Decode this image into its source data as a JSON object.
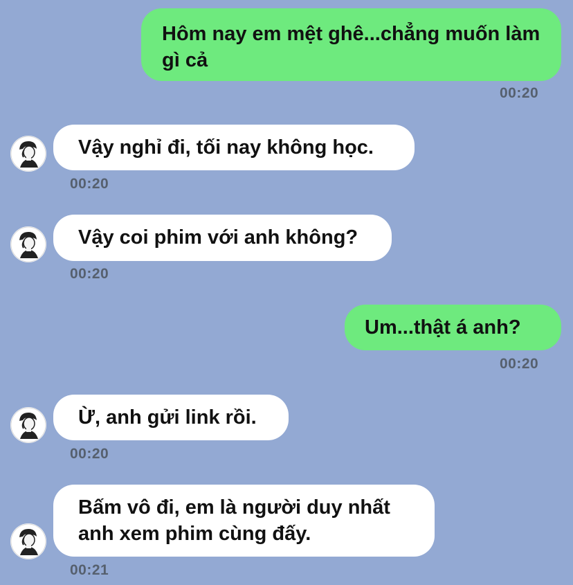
{
  "messages": [
    {
      "side": "out",
      "text": "Hôm nay em mệt ghê...chẳng muốn làm gì cả",
      "time": "00:20"
    },
    {
      "side": "in",
      "text": "Vậy nghỉ đi, tối nay không học.",
      "time": "00:20",
      "avatar": "profile-avatar"
    },
    {
      "side": "in",
      "text": "Vậy coi phim với anh không?",
      "time": "00:20",
      "avatar": "profile-avatar"
    },
    {
      "side": "out",
      "text": "Um...thật á anh?",
      "time": "00:20"
    },
    {
      "side": "in",
      "text": "Ừ, anh gửi link rồi.",
      "time": "00:20",
      "avatar": "profile-avatar"
    },
    {
      "side": "in",
      "text": "Bấm vô đi, em là người duy nhất anh xem phim cùng đấy.",
      "time": "00:21",
      "avatar": "profile-avatar"
    }
  ],
  "colors": {
    "background": "#93a9d3",
    "outgoing_bubble": "#6eea7e",
    "incoming_bubble": "#ffffff",
    "timestamp": "#56606e"
  }
}
